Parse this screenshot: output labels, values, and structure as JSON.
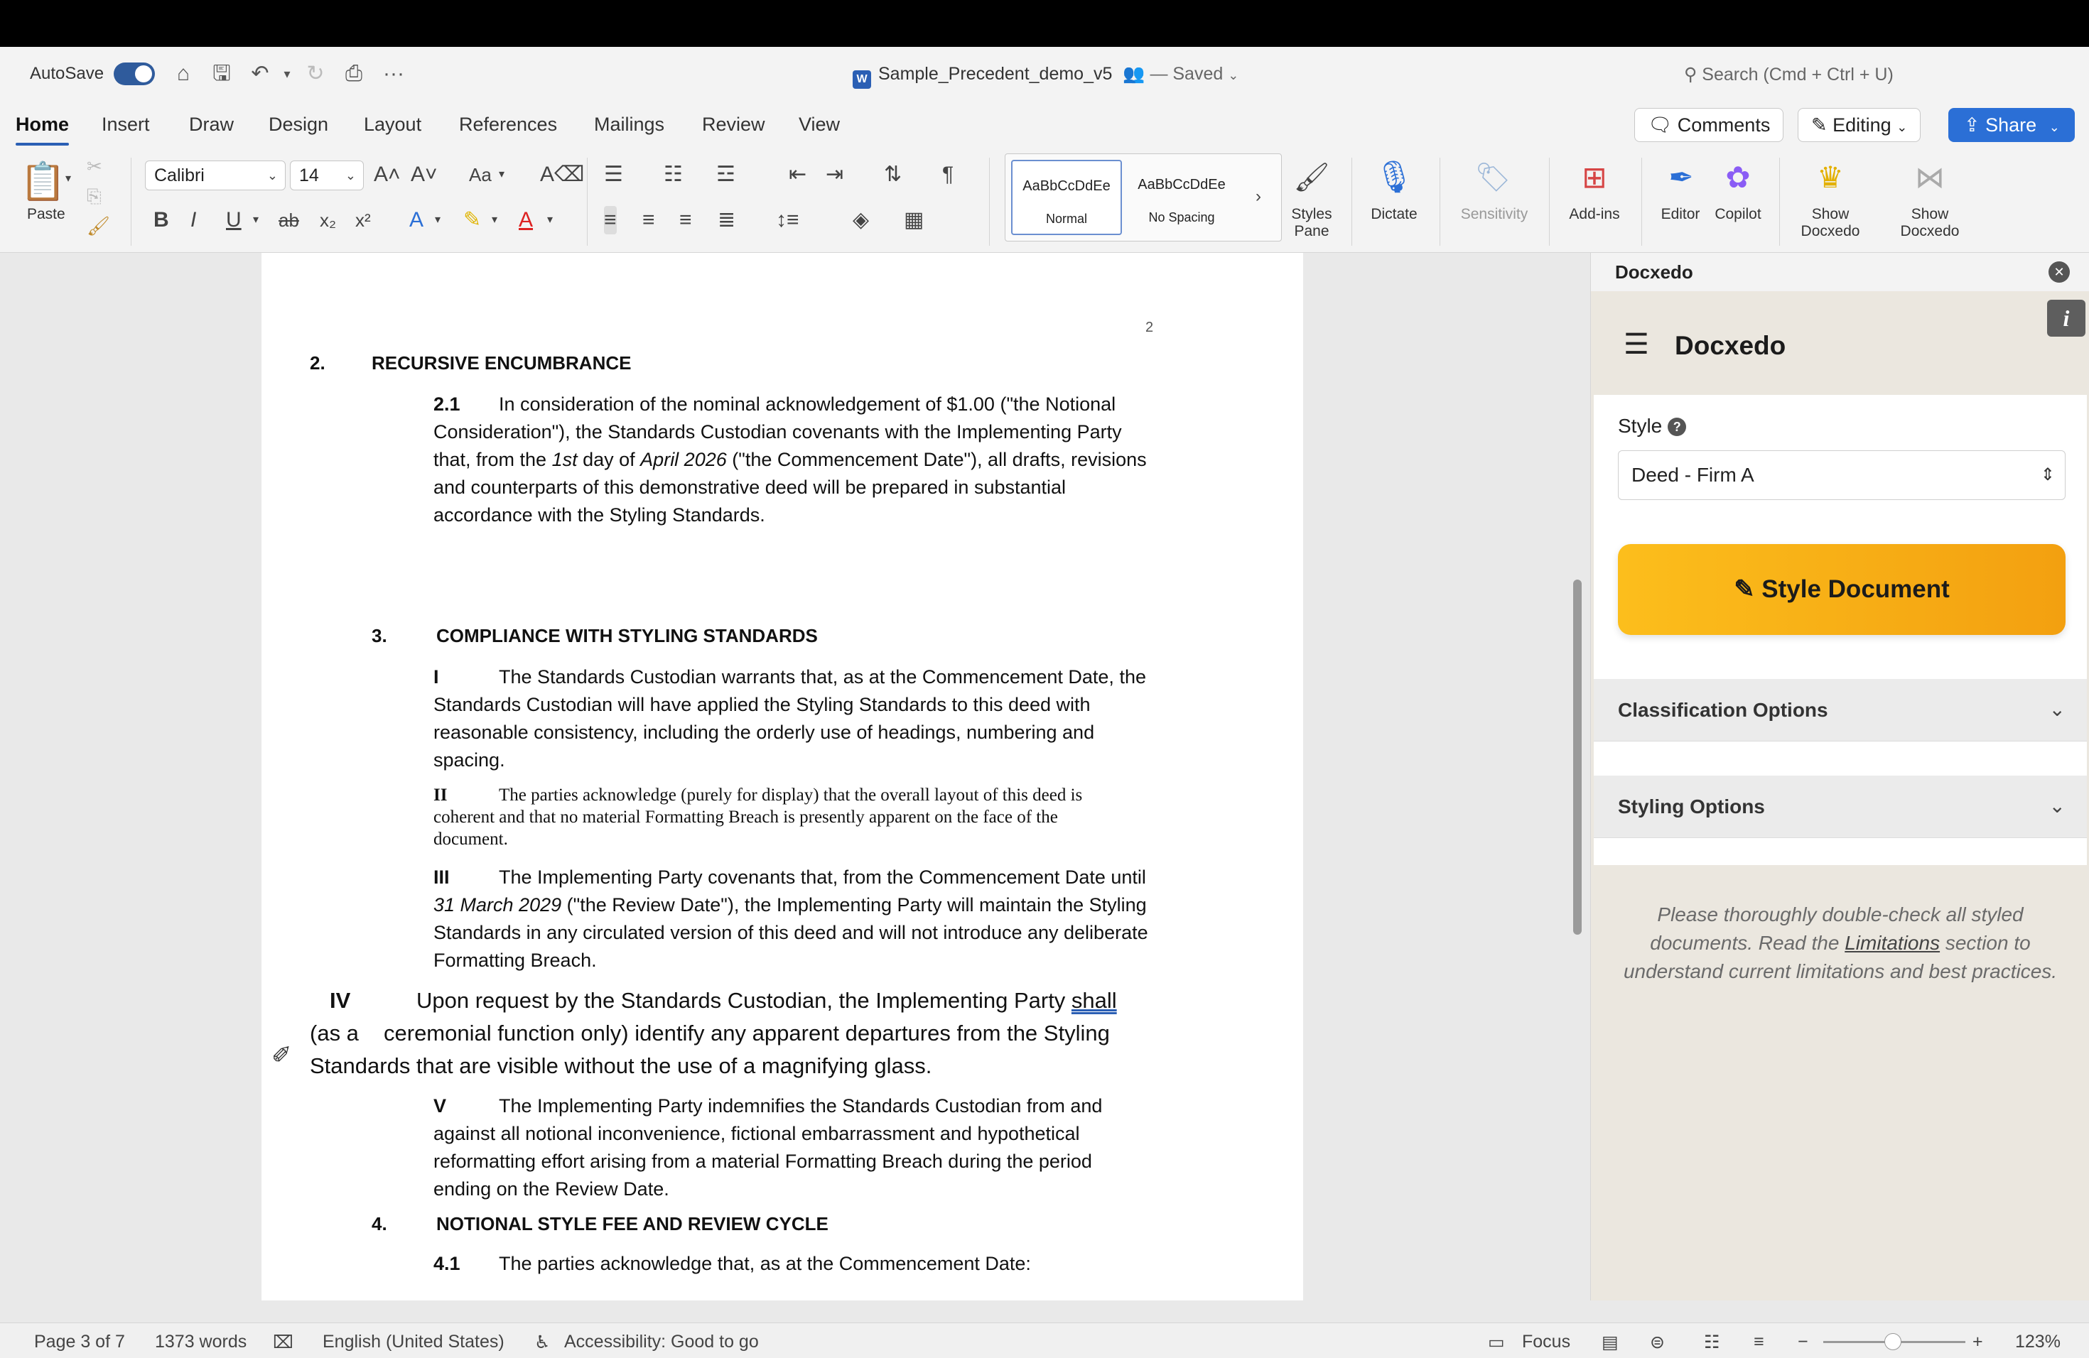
{
  "titlebar": {
    "autosave_label": "AutoSave",
    "document_name": "Sample_Precedent_demo_v5",
    "save_status": "— Saved",
    "search_placeholder": "Search (Cmd + Ctrl + U)"
  },
  "tabs": [
    "Home",
    "Insert",
    "Draw",
    "Design",
    "Layout",
    "References",
    "Mailings",
    "Review",
    "View"
  ],
  "top_actions": {
    "comments": "Comments",
    "editing": "Editing",
    "share": "Share"
  },
  "ribbon": {
    "paste": "Paste",
    "font_name": "Calibri",
    "font_size": "14",
    "change_case": "Aa",
    "styles": [
      {
        "sample": "AaBbCcDdEe",
        "name": "Normal"
      },
      {
        "sample": "AaBbCcDdEe",
        "name": "No Spacing"
      }
    ],
    "styles_pane": [
      "Styles",
      "Pane"
    ],
    "dictate": "Dictate",
    "sensitivity": "Sensitivity",
    "addins": "Add-ins",
    "editor": "Editor",
    "copilot": "Copilot",
    "show_docxedo_1": [
      "Show",
      "Docxedo"
    ],
    "show_docxedo_2": [
      "Show",
      "Docxedo"
    ]
  },
  "document": {
    "page_number": "2",
    "clause2": {
      "num": "2.",
      "heading": "RECURSIVE ENCUMBRANCE",
      "sub_num": "2.1",
      "text_a": "In consideration of the nominal acknowledgement of $1.00 (\"the Notional Consideration\"), the Standards Custodian covenants with the Implementing Party that, from the ",
      "text_date_1": "1st",
      "text_b": " day of ",
      "text_date_2": "April 2026",
      "text_c": " (\"the Commencement Date\"), all drafts, revisions and counterparts of this demonstrative deed will be prepared in substantial accordance with the Styling Standards."
    },
    "clause3": {
      "num": "3.",
      "heading": "COMPLIANCE WITH STYLING STANDARDS",
      "items": {
        "i_num": "I",
        "i_text": "The Standards Custodian warrants that, as at the Commencement Date, the Standards Custodian will have applied the Styling Standards to this deed with reasonable consistency, including the orderly use of headings, numbering and spacing.",
        "ii_num": "II",
        "ii_text": "The parties acknowledge (purely for display) that the overall layout of this deed is coherent and that no material Formatting Breach is presently apparent on the face of the document.",
        "iii_num": "III",
        "iii_text_a": "The Implementing Party covenants that, from the Commencement Date until ",
        "iii_date": "31 March 2029",
        "iii_text_b": " (\"the Review Date\"), the Implementing Party will maintain the Styling Standards in any circulated version of this deed and will not introduce any deliberate Formatting Breach.",
        "iv_num": "IV",
        "iv_line1": "Upon request by the Standards Custodian, the Implementing Party ",
        "iv_shall": "shall",
        "iv_as_a": "(as a",
        "iv_line2": "ceremonial function only) identify any apparent departures from the Styling",
        "iv_line3": "Standards that are visible without the use of a magnifying glass.",
        "v_num": "V",
        "v_text": "The Implementing Party indemnifies the Standards Custodian from and against all notional inconvenience, fictional embarrassment and hypothetical reformatting effort arising from a material Formatting Breach during the period ending on the Review Date."
      }
    },
    "clause4": {
      "num": "4.",
      "heading": "NOTIONAL STYLE FEE AND REVIEW CYCLE",
      "sub_num": "4.1",
      "text": "The parties acknowledge that, as at the Commencement Date:"
    }
  },
  "pane": {
    "title": "Docxedo",
    "brand": "Docxedo",
    "style_label": "Style",
    "style_value": "Deed - Firm A",
    "style_button": "Style Document",
    "classification": "Classification Options",
    "styling": "Styling Options",
    "note_a": "Please thoroughly double-check all styled documents. Read the ",
    "note_link": "Limitations",
    "note_b": " section to understand current limitations and best practices."
  },
  "statusbar": {
    "page": "Page 3 of 7",
    "words": "1373 words",
    "language": "English (United States)",
    "accessibility": "Accessibility: Good to go",
    "focus": "Focus",
    "zoom": "123%"
  }
}
